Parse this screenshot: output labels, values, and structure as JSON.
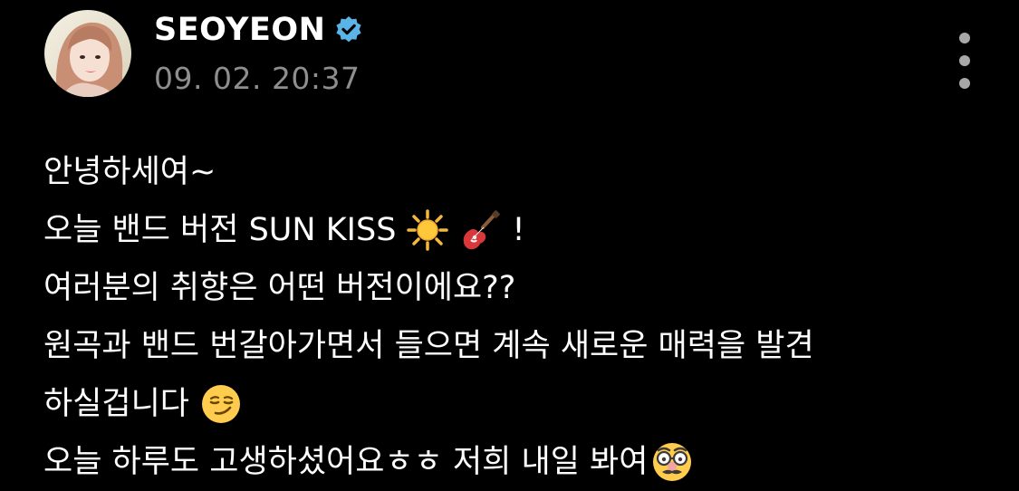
{
  "author": {
    "name": "SEOYEON",
    "timestamp": "09. 02. 20:37"
  },
  "icons": {
    "avatar": "profile-photo",
    "verified": "verified-badge-icon",
    "more": "more-vertical-icon"
  },
  "colors": {
    "background": "#000000",
    "text": "#ffffff",
    "timestamp": "#8e8e8e",
    "verified": "#5ab4e5"
  },
  "post": {
    "lines": [
      {
        "text": "안녕하세여~"
      },
      {
        "text": "오늘 밴드 버전 SUN KISS",
        "emojis": [
          "sun",
          "guitar"
        ],
        "suffix": "!"
      },
      {
        "text": "여러분의 취향은 어떤 버전이에요??"
      },
      {
        "text": "원곡과 밴드 번갈아가면서 들으면 계속 새로운 매력을 발견"
      },
      {
        "text": "하실겁니다",
        "emojis": [
          "smirking-face"
        ]
      },
      {
        "text": "오늘 하루도 고생하셨어요ㅎㅎ 저희 내일 봐여",
        "emojis": [
          "disguised-face"
        ]
      }
    ]
  }
}
